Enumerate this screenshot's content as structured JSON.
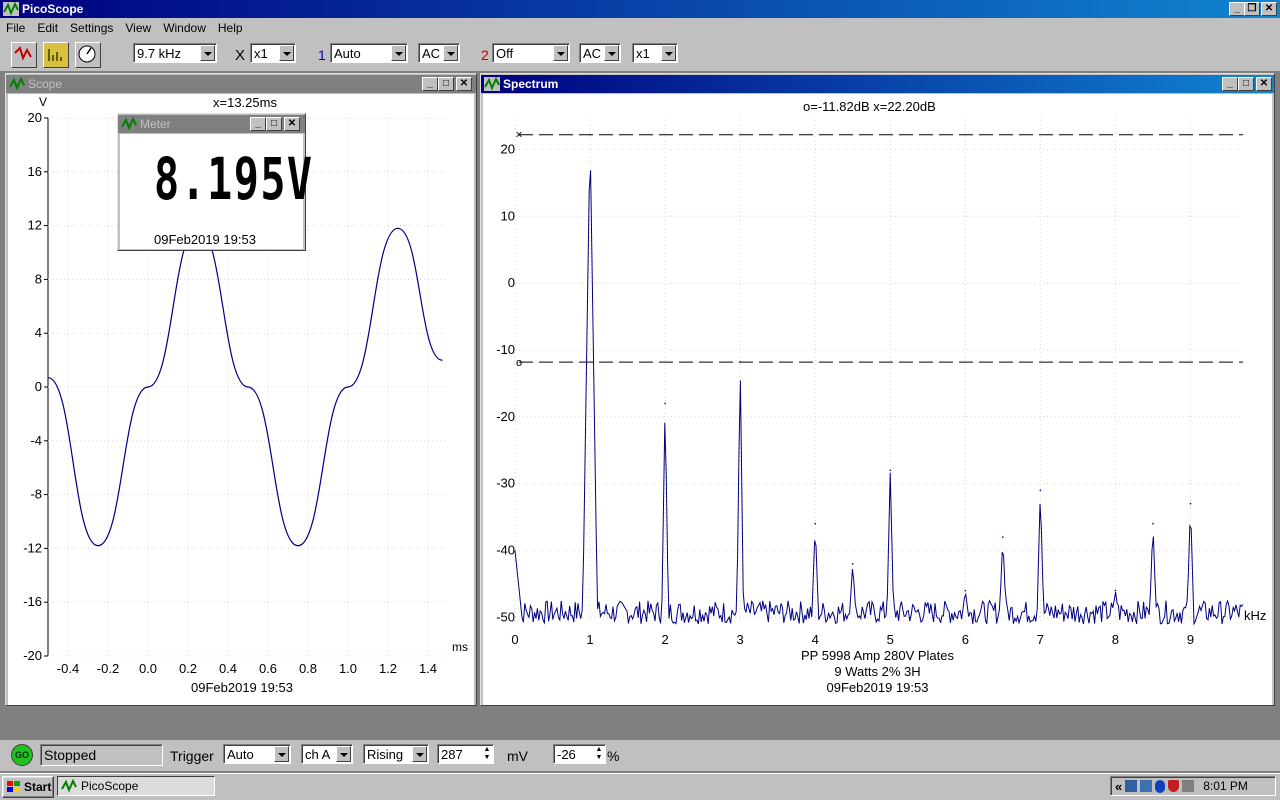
{
  "app": {
    "title": "PicoScope",
    "menu": [
      "File",
      "Edit",
      "Settings",
      "View",
      "Window",
      "Help"
    ]
  },
  "toolbar": {
    "timebase": "9.7 kHz",
    "x_label": "X",
    "x_mult": "x1",
    "ch1_num": "1",
    "ch1_range": "Auto",
    "ch1_coupling": "AC",
    "ch2_num": "2",
    "ch2_range": "Off",
    "ch2_coupling": "AC",
    "ch2_mult": "x1",
    "colors": {
      "ch1": "#0000c0",
      "ch2": "#c00000"
    }
  },
  "scope": {
    "title": "Scope",
    "unit_y": "V",
    "cursor_readout": "x=13.25ms",
    "unit_x": "ms",
    "timestamp": "09Feb2019  19:53",
    "y_ticks": [
      "20",
      "16",
      "12",
      "8",
      "4",
      "0",
      "-4",
      "-8",
      "-12",
      "-16",
      "-20"
    ],
    "x_ticks": [
      "-0.4",
      "-0.2",
      "0.0",
      "0.2",
      "0.4",
      "0.6",
      "0.8",
      "1.0",
      "1.2",
      "1.4"
    ],
    "trace_color": "#000080"
  },
  "meter": {
    "title": "Meter",
    "value": "8.195V",
    "timestamp": "09Feb2019  19:53"
  },
  "spectrum": {
    "title": "Spectrum",
    "cursor_readout": "o=-11.82dB  x=22.20dB",
    "unit_x": "kHz",
    "y_ticks": [
      "20",
      "10",
      "0",
      "-10",
      "-20",
      "-30",
      "-40",
      "-50"
    ],
    "x_ticks": [
      "0",
      "1",
      "2",
      "3",
      "4",
      "5",
      "6",
      "7",
      "8",
      "9"
    ],
    "caption": [
      "PP 5998  Amp 280V Plates",
      "9 Watts 2% 3H",
      "09Feb2019  19:53"
    ],
    "cursor_x_marker": "×",
    "cursor_o_marker": "o",
    "trace_color": "#000080"
  },
  "chart_data": [
    {
      "type": "line",
      "title": "",
      "xlabel": "ms",
      "ylabel": "V",
      "xlim": [
        -0.5,
        1.5
      ],
      "ylim": [
        -20,
        20
      ],
      "series": [
        {
          "x": [
            -0.5,
            -0.25,
            0.0,
            0.25,
            0.5,
            0.75,
            1.0,
            1.25,
            1.47
          ],
          "values": [
            0.7,
            -11.8,
            0.0,
            11.8,
            0.0,
            -11.8,
            0.0,
            11.8,
            2.0
          ]
        }
      ]
    },
    {
      "type": "line",
      "title": "",
      "xlabel": "kHz",
      "ylabel": "dB",
      "xlim": [
        0,
        9.7
      ],
      "ylim": [
        -51,
        25
      ],
      "cursors": {
        "x": 22.2,
        "o": -11.82
      },
      "series": [
        {
          "x": [
            1,
            2,
            3,
            4,
            4.5,
            5,
            6,
            6.5,
            7,
            8,
            8.5,
            9
          ],
          "values": [
            22.2,
            -18,
            -11.8,
            -36,
            -42,
            -28,
            -46,
            -38,
            -31,
            -46,
            -36,
            -33
          ]
        }
      ]
    }
  ],
  "status": {
    "go": "GO",
    "state": "Stopped",
    "trigger_label": "Trigger",
    "trigger_mode": "Auto",
    "trigger_channel": "ch A",
    "trigger_edge": "Rising",
    "threshold": "287",
    "threshold_unit": "mV",
    "pretrigger": "-26",
    "pretrigger_unit": "%"
  },
  "taskbar": {
    "start": "Start",
    "task": "PicoScope",
    "tray_arrows": "«",
    "clock": "8:01 PM"
  }
}
